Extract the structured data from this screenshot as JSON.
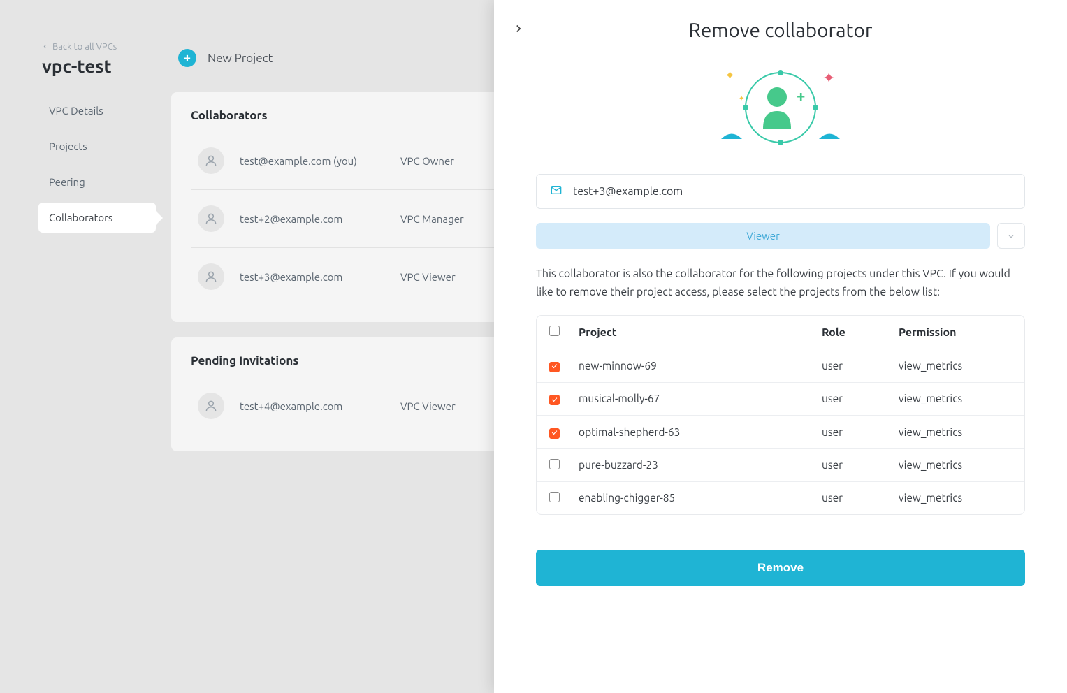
{
  "back_link": "Back to all VPCs",
  "vpc_name": "vpc-test",
  "nav": {
    "items": [
      {
        "label": "VPC Details",
        "active": false
      },
      {
        "label": "Projects",
        "active": false
      },
      {
        "label": "Peering",
        "active": false
      },
      {
        "label": "Collaborators",
        "active": true
      }
    ]
  },
  "new_project_label": "New Project",
  "collaborators": {
    "title": "Collaborators",
    "rows": [
      {
        "email": "test@example.com (you)",
        "role": "VPC Owner"
      },
      {
        "email": "test+2@example.com",
        "role": "VPC Manager"
      },
      {
        "email": "test+3@example.com",
        "role": "VPC Viewer"
      }
    ]
  },
  "pending": {
    "title": "Pending Invitations",
    "rows": [
      {
        "email": "test+4@example.com",
        "role": "VPC Viewer"
      }
    ]
  },
  "drawer": {
    "title": "Remove collaborator",
    "email": "test+3@example.com",
    "role_label": "Viewer",
    "description": "This collaborator is also the collaborator for the following projects under this VPC. If you would like to remove their project access, please select the projects from the below list:",
    "table_headers": {
      "project": "Project",
      "role": "Role",
      "permission": "Permission"
    },
    "projects": [
      {
        "name": "new-minnow-69",
        "role": "user",
        "permission": "view_metrics",
        "checked": true
      },
      {
        "name": "musical-molly-67",
        "role": "user",
        "permission": "view_metrics",
        "checked": true
      },
      {
        "name": "optimal-shepherd-63",
        "role": "user",
        "permission": "view_metrics",
        "checked": true
      },
      {
        "name": "pure-buzzard-23",
        "role": "user",
        "permission": "view_metrics",
        "checked": false
      },
      {
        "name": "enabling-chigger-85",
        "role": "user",
        "permission": "view_metrics",
        "checked": false
      }
    ],
    "remove_button": "Remove"
  }
}
